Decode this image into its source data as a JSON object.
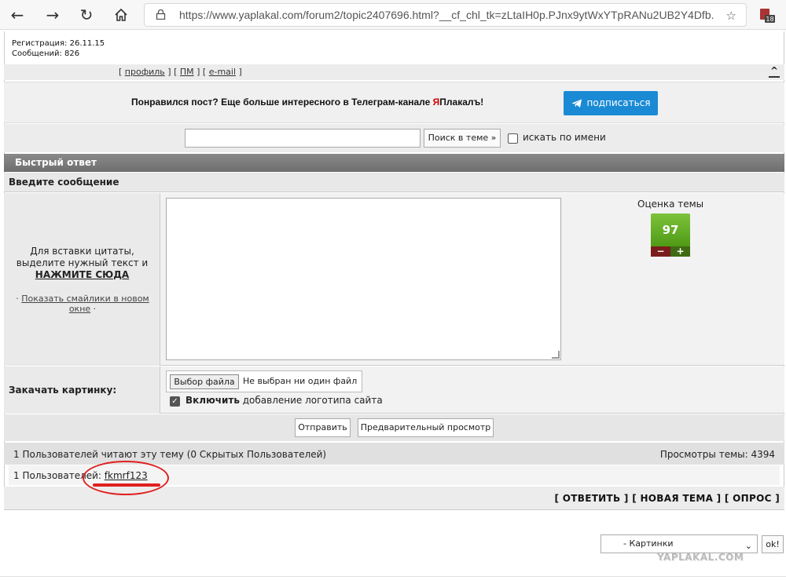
{
  "browser": {
    "url": "https://www.yaplakal.com/forum2/topic2407696.html?__cf_chl_tk=zLtaIH0p.PJnx9ytWxYTpRANu2UB2Y4Dfb...",
    "ext_badge": "18"
  },
  "user": {
    "registration": "Регистрация: 26.11.15",
    "messages": "Сообщений: 826"
  },
  "profile_links": {
    "profile": "профиль",
    "pm": "ПМ",
    "email": "e-mail",
    "top": "^"
  },
  "promo": {
    "text_before": "Понравился пост? Еще больше интересного в Телеграм-канале ",
    "text_red": "Я",
    "text_after": "Плакалъ!",
    "subscribe": "подписаться"
  },
  "search": {
    "button": "Поиск в теме »",
    "by_name": "искать по имени"
  },
  "quick_reply": {
    "header": "Быстрый ответ",
    "enter_message": "Введите сообщение",
    "help_line1": "Для вставки цитаты,",
    "help_line2": "выделите нужный текст и",
    "help_bold": "НАЖМИТЕ СЮДА",
    "smiles_prefix": "· ",
    "smiles_link": "Показать смайлики в новом окне",
    "smiles_suffix": " ·"
  },
  "rating": {
    "label": "Оценка темы",
    "value": "97",
    "minus": "−",
    "plus": "+"
  },
  "upload": {
    "label": "Закачать картинку:",
    "choose": "Выбор файла",
    "none": "Не выбран ни один файл",
    "logo_bold": "Включить",
    "logo_rest": " добавление логотипа сайта"
  },
  "buttons": {
    "send": "Отправить",
    "preview": "Предварительный просмотр"
  },
  "stats": {
    "readers": "1 Пользователей читают эту тему (0 Скрытых Пользователей)",
    "views": "Просмотры темы: 4394",
    "users_prefix": "1 Пользователей: ",
    "username": "fkmrf123"
  },
  "actions": {
    "reply": "[ ОТВЕТИТЬ ]",
    "new_topic": "[ НОВАЯ ТЕМА ]",
    "poll": "[ ОПРОС ]"
  },
  "bottom": {
    "select_value": "- Картинки",
    "ok": "ok!",
    "watermark": "YAPLAKAL.COM"
  },
  "colors": {
    "telegram": "#1a8ad5",
    "rating_green": "#5fa61f",
    "annotation_red": "#e02020"
  }
}
